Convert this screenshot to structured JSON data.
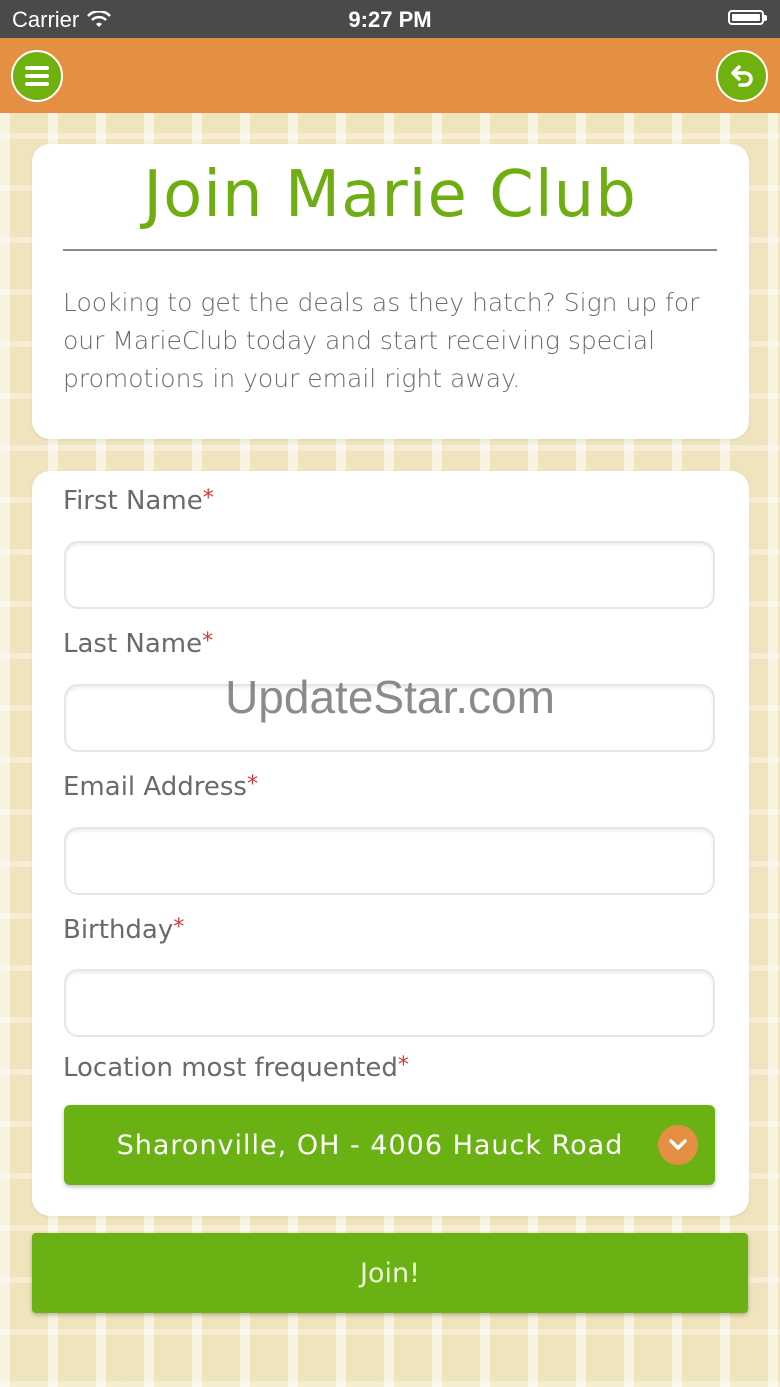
{
  "status_bar": {
    "carrier": "Carrier",
    "time": "9:27 PM"
  },
  "nav": {
    "menu_icon": "hamburger-menu-icon",
    "back_icon": "undo-arrow-icon"
  },
  "intro": {
    "title": "Join Marie Club",
    "description": "Looking to get the deals as they hatch? Sign up for our MarieClub today and start receiving special promotions in your email right away."
  },
  "form": {
    "required_mark": "*",
    "first_name": {
      "label": "First Name",
      "value": "",
      "placeholder": ""
    },
    "last_name": {
      "label": "Last Name",
      "value": "",
      "placeholder": ""
    },
    "email": {
      "label": "Email Address",
      "value": "",
      "placeholder": ""
    },
    "birthday": {
      "label": "Birthday",
      "value": "",
      "placeholder": ""
    },
    "location": {
      "label": "Location most frequented",
      "selected": "Sharonville, OH - 4006 Hauck Road"
    },
    "submit_label": "Join!"
  },
  "watermark": "UpdateStar.com",
  "colors": {
    "accent_green": "#6ab113",
    "nav_orange": "#e58f42",
    "title_green": "#6fae13",
    "required_red": "#d23a3a"
  }
}
